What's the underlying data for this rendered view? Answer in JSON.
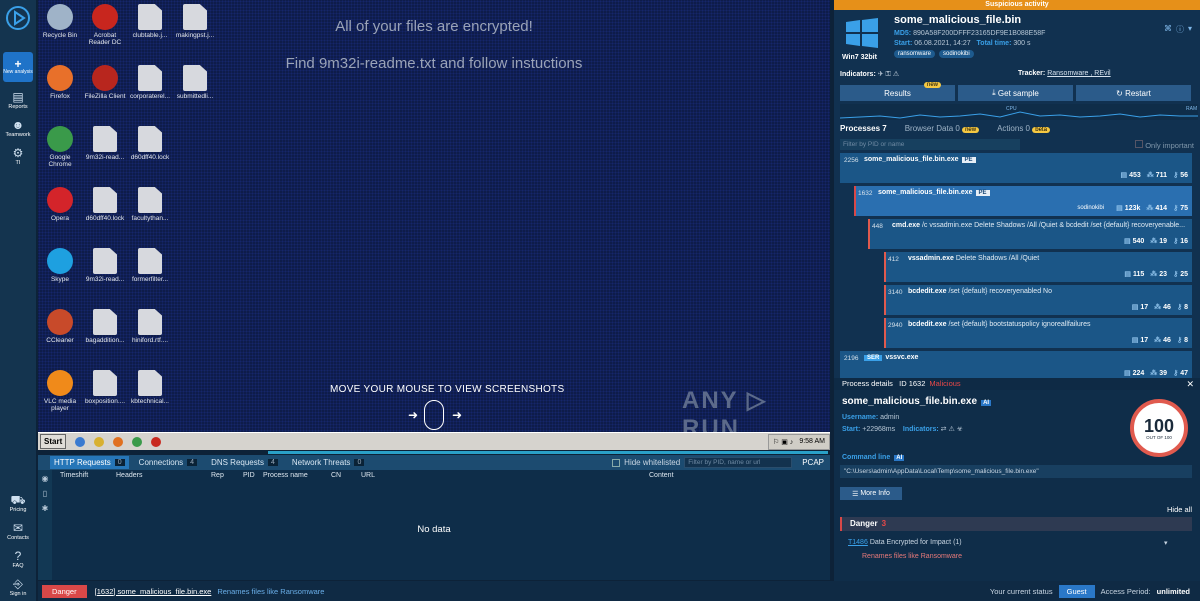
{
  "nav": {
    "new_label": "New analysis",
    "items": [
      {
        "label": "Reports",
        "icon": "reports-icon",
        "glyph": "▤"
      },
      {
        "label": "Teamwork",
        "icon": "teamwork-icon",
        "glyph": "☻"
      },
      {
        "label": "TI",
        "icon": "gear-icon",
        "glyph": "⚙"
      }
    ],
    "bottom": [
      {
        "label": "Pricing",
        "icon": "cart-icon",
        "glyph": "⛟"
      },
      {
        "label": "Contacts",
        "icon": "mail-icon",
        "glyph": "✉"
      },
      {
        "label": "FAQ",
        "icon": "help-icon",
        "glyph": "?"
      },
      {
        "label": "Sign in",
        "icon": "signin-icon",
        "glyph": "⎆"
      }
    ]
  },
  "desktop": {
    "line1": "All of your files are encrypted!",
    "line2": "Find 9m32i-readme.txt and follow instuctions",
    "hint": "MOVE YOUR MOUSE TO VIEW SCREENSHOTS",
    "watermark": "ANY ▷ RUN",
    "icons": [
      {
        "label": "Recycle Bin",
        "color": "#9fb3c8"
      },
      {
        "label": "Acrobat Reader DC",
        "color": "#c8261e"
      },
      {
        "label": "clubtable.j...",
        "color": "file"
      },
      {
        "label": "makingpst.j...",
        "color": "file"
      },
      {
        "label": "Firefox",
        "color": "#e8702a"
      },
      {
        "label": "FileZilla Client",
        "color": "#b8261e"
      },
      {
        "label": "corporaterel...",
        "color": "file"
      },
      {
        "label": "submittedli...",
        "color": "file"
      },
      {
        "label": "Google Chrome",
        "color": "#3a9a4a"
      },
      {
        "label": "9m32i-read...",
        "color": "file"
      },
      {
        "label": "d60dff40.lock",
        "color": "file"
      },
      {
        "label": "Opera",
        "color": "#d4242a"
      },
      {
        "label": "d60dff40.lock",
        "color": "file"
      },
      {
        "label": "facultythan...",
        "color": "file"
      },
      {
        "label": "Skype",
        "color": "#1ea0e0"
      },
      {
        "label": "9m32i-read...",
        "color": "file"
      },
      {
        "label": "formerfilter...",
        "color": "file"
      },
      {
        "label": "CCleaner",
        "color": "#c84a2a"
      },
      {
        "label": "bagaddition...",
        "color": "file"
      },
      {
        "label": "hiniford.rtf....",
        "color": "file"
      },
      {
        "label": "VLC media player",
        "color": "#f08a1a"
      },
      {
        "label": "boxposition....",
        "color": "file"
      },
      {
        "label": "kbtechnical...",
        "color": "file"
      }
    ]
  },
  "taskbar": {
    "start": "Start",
    "time": "9:58 AM"
  },
  "network": {
    "tabs": [
      {
        "label": "HTTP Requests",
        "count": "0"
      },
      {
        "label": "Connections",
        "count": "4"
      },
      {
        "label": "DNS Requests",
        "count": "4"
      },
      {
        "label": "Network Threats",
        "count": "0"
      }
    ],
    "hide_whitelisted": "Hide whitelisted",
    "filter_placeholder": "Filter by PID, name or url",
    "pcap": "PCAP",
    "columns": [
      "Timeshift",
      "Headers",
      "Rep",
      "PID",
      "Process name",
      "CN",
      "URL",
      "Content"
    ],
    "empty": "No data"
  },
  "status": {
    "badge": "Danger",
    "process": "[1632] some_malicious_file.bin.exe",
    "description": "Renames files like Ransomware",
    "current_status_label": "Your current status",
    "guest": "Guest",
    "access_label": "Access Period:",
    "access_value": "unlimited"
  },
  "panel": {
    "alert": "Suspicious activity",
    "os": "Win7 32bit",
    "filename": "some_malicious_file.bin",
    "md5_label": "MD5:",
    "md5": "890A58F200DFFF23165DF9E1B088E58F",
    "start_label": "Start:",
    "start": "06.08.2021, 14:27",
    "total_label": "Total time:",
    "total": "300 s",
    "tags": [
      "ransomware",
      "sodinokibi"
    ],
    "indicators_label": "Indicators:",
    "tracker_label": "Tracker:",
    "tracker_value": "Ransomware , REvil",
    "btn_results": "Results",
    "btn_results_badge": "new",
    "btn_sample": "Get sample",
    "btn_restart": "Restart",
    "cpu_label": "CPU",
    "ram_label": "RAM",
    "tab_processes": "Processes 7",
    "tab_browser": "Browser Data 0",
    "tab_browser_badge": "new",
    "tab_actions": "Actions 0",
    "tab_actions_badge": "beta",
    "filter_placeholder": "Filter by PID or name",
    "only_important": "Only important",
    "processes": [
      {
        "pid": "2256",
        "name": "some_malicious_file.bin.exe",
        "cmd": "",
        "pe": "PE",
        "s1": "453",
        "s2": "711",
        "s3": "56"
      },
      {
        "pid": "1632",
        "name": "some_malicious_file.bin.exe",
        "cmd": "",
        "pe": "PE",
        "tag": "sodinokibi",
        "s1": "123k",
        "s2": "414",
        "s3": "75"
      },
      {
        "pid": "448",
        "name": "cmd.exe",
        "cmd": "/c vssadmin.exe Delete Shadows /All /Quiet & bcdedit /set {default} recoveryenable...",
        "s1": "540",
        "s2": "19",
        "s3": "16"
      },
      {
        "pid": "412",
        "name": "vssadmin.exe",
        "cmd": "Delete Shadows /All /Quiet",
        "s1": "115",
        "s2": "23",
        "s3": "25"
      },
      {
        "pid": "3140",
        "name": "bcdedit.exe",
        "cmd": "/set {default} recoveryenabled No",
        "s1": "17",
        "s2": "46",
        "s3": "8"
      },
      {
        "pid": "2940",
        "name": "bcdedit.exe",
        "cmd": "/set {default} bootstatuspolicy ignoreallfailures",
        "s1": "17",
        "s2": "46",
        "s3": "8"
      },
      {
        "pid": "2196",
        "name": "vssvc.exe",
        "cmd": "",
        "ser": "SER",
        "s1": "224",
        "s2": "39",
        "s3": "47"
      }
    ],
    "details": {
      "title": "Process details",
      "id": "ID 1632",
      "verdict": "Malicious",
      "name": "some_malicious_file.bin.exe",
      "ai": "AI",
      "username_label": "Username:",
      "username": "admin",
      "start_label": "Start:",
      "start": "+22968ms",
      "indicators_label": "Indicators:",
      "score": "100",
      "score_of": "OUT OF 100",
      "cmdline_label": "Command line",
      "cmdline": "\"C:\\Users\\admin\\AppData\\Local\\Temp\\some_malicious_file.bin.exe\"",
      "more_info": "More Info",
      "hide_all": "Hide all",
      "danger_label": "Danger",
      "danger_count": "3",
      "technique_id": "T1486",
      "technique": "Data Encrypted for Impact (1)",
      "behavior": "Renames files like Ransomware"
    }
  }
}
